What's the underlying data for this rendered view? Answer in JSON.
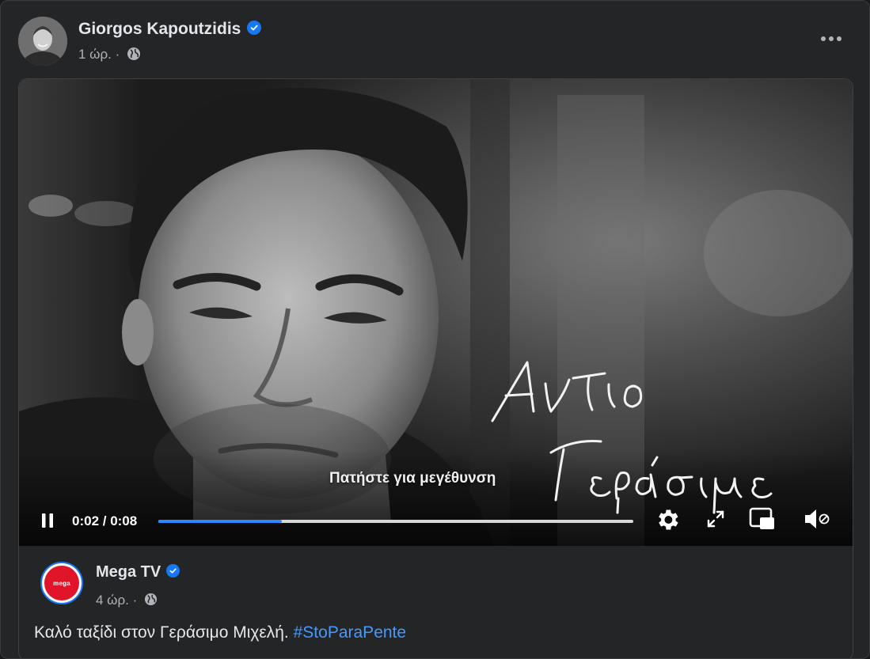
{
  "post": {
    "author": "Giorgos Kapoutzidis",
    "time": "1 ώρ.",
    "separator": "·"
  },
  "video": {
    "overlay_hint": "Πατήστε για μεγέθυνση",
    "signature_text": "Αντίο Γεράσιμε",
    "time_display": "0:02 / 0:08",
    "progress": 0.26
  },
  "shared_page": {
    "name": "Mega TV",
    "logo_text": "mega",
    "time": "4 ώρ.",
    "separator": "·",
    "caption_text": "Καλό ταξίδι στον Γεράσιμο Μιχελή.",
    "hashtag": "#StoParaPente"
  },
  "colors": {
    "background": "#242526",
    "accent": "#1877f2",
    "progress": "#2d88ff",
    "hashtag": "#4599ff"
  },
  "icons": [
    "verified-badge-icon",
    "globe-icon",
    "more-options-icon",
    "pause-icon",
    "settings-gear-icon",
    "fullscreen-icon",
    "picture-in-picture-icon",
    "volume-muted-icon"
  ]
}
